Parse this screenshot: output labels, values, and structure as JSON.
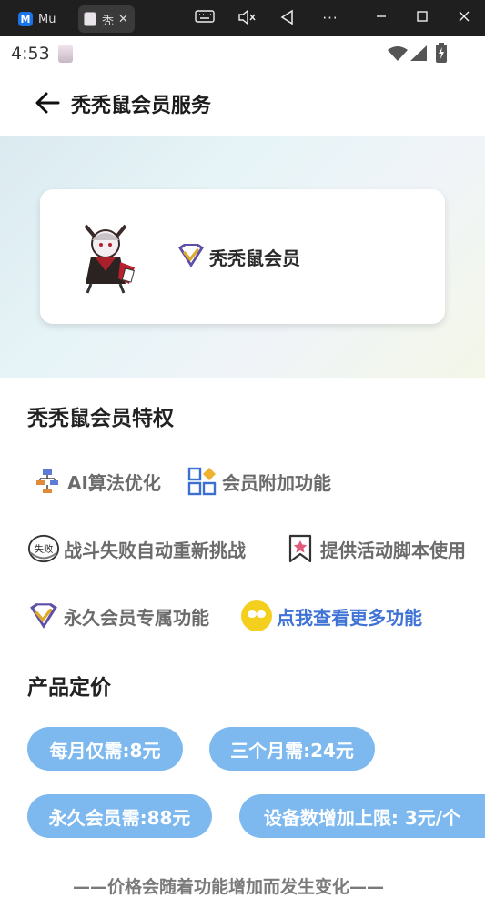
{
  "emulator": {
    "tabs": [
      {
        "title": "Mu",
        "active": false
      },
      {
        "title": "秃",
        "active": true
      }
    ],
    "icons": [
      "keyboard-icon",
      "mute-icon",
      "back-triangle-icon",
      "more-icon",
      "minimize-icon",
      "maximize-icon",
      "close-icon"
    ]
  },
  "status_bar": {
    "time": "4:53",
    "icons": [
      "wifi-icon",
      "signal-icon",
      "battery-charging-icon"
    ]
  },
  "header": {
    "title": "秃秃鼠会员服务"
  },
  "member_card": {
    "name": "秃秃鼠会员"
  },
  "privileges": {
    "title": "秃秃鼠会员特权",
    "items": [
      {
        "label": "AI算法优化",
        "icon": "flowchart-icon"
      },
      {
        "label": "会员附加功能",
        "icon": "apps-grid-icon"
      },
      {
        "label": "战斗失败自动重新挑战",
        "icon": "defeat-stamp-icon"
      },
      {
        "label": "提供活动脚本使用",
        "icon": "star-bookmark-icon"
      },
      {
        "label": "永久会员专属功能",
        "icon": "vip-badge-icon"
      },
      {
        "label": "点我查看更多功能",
        "icon": "emoji-icon"
      }
    ]
  },
  "pricing": {
    "title": "产品定价",
    "options": [
      {
        "label": "每月仅需:8元"
      },
      {
        "label": "三个月需:24元"
      },
      {
        "label": "永久会员需:88元"
      },
      {
        "label": "设备数增加上限: 3元/个"
      }
    ],
    "note": "——价格会随着功能增加而发生变化——"
  },
  "colors": {
    "accent_blue": "#7db9ef",
    "link_blue": "#3f73d6",
    "badge_purple": "#5b4fa8",
    "badge_gold": "#e0a92a"
  }
}
